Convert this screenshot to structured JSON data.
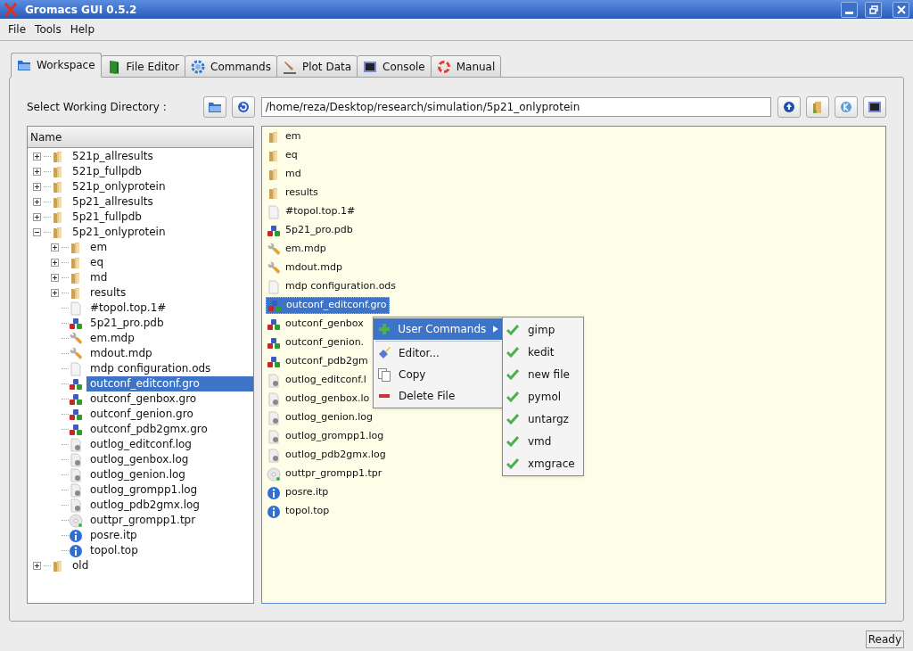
{
  "window": {
    "title": "Gromacs GUI 0.5.2"
  },
  "menubar": [
    "File",
    "Tools",
    "Help"
  ],
  "tabs": [
    {
      "label": "Workspace",
      "selected": true
    },
    {
      "label": "File Editor",
      "selected": false
    },
    {
      "label": "Commands",
      "selected": false
    },
    {
      "label": "Plot Data",
      "selected": false
    },
    {
      "label": "Console",
      "selected": false
    },
    {
      "label": "Manual",
      "selected": false
    }
  ],
  "directory": {
    "label": "Select Working Directory :",
    "path": "/home/reza/Desktop/research/simulation/5p21_onlyprotein"
  },
  "tree": {
    "column": "Name",
    "items": [
      {
        "label": "521p_allresults",
        "kind": "folder",
        "expanded": false,
        "selected": false
      },
      {
        "label": "521p_fullpdb",
        "kind": "folder",
        "expanded": false,
        "selected": false
      },
      {
        "label": "521p_onlyprotein",
        "kind": "folder",
        "expanded": false,
        "selected": false
      },
      {
        "label": "5p21_allresults",
        "kind": "folder",
        "expanded": false,
        "selected": false
      },
      {
        "label": "5p21_fullpdb",
        "kind": "folder",
        "expanded": false,
        "selected": false
      },
      {
        "label": "5p21_onlyprotein",
        "kind": "folder",
        "expanded": true,
        "selected": false,
        "children": [
          {
            "label": "em",
            "kind": "folder",
            "expanded": false,
            "selected": false
          },
          {
            "label": "eq",
            "kind": "folder",
            "expanded": false,
            "selected": false
          },
          {
            "label": "md",
            "kind": "folder",
            "expanded": false,
            "selected": false
          },
          {
            "label": "results",
            "kind": "folder",
            "expanded": false,
            "selected": false
          },
          {
            "label": "#topol.top.1#",
            "kind": "blank",
            "selected": false
          },
          {
            "label": "5p21_pro.pdb",
            "kind": "molecule",
            "selected": false
          },
          {
            "label": "em.mdp",
            "kind": "wrench",
            "selected": false
          },
          {
            "label": "mdout.mdp",
            "kind": "wrench",
            "selected": false
          },
          {
            "label": "mdp configuration.ods",
            "kind": "blank",
            "selected": false
          },
          {
            "label": "outconf_editconf.gro",
            "kind": "molecule",
            "selected": true
          },
          {
            "label": "outconf_genbox.gro",
            "kind": "molecule",
            "selected": false
          },
          {
            "label": "outconf_genion.gro",
            "kind": "molecule",
            "selected": false
          },
          {
            "label": "outconf_pdb2gmx.gro",
            "kind": "molecule",
            "selected": false
          },
          {
            "label": "outlog_editconf.log",
            "kind": "log",
            "selected": false
          },
          {
            "label": "outlog_genbox.log",
            "kind": "log",
            "selected": false
          },
          {
            "label": "outlog_genion.log",
            "kind": "log",
            "selected": false
          },
          {
            "label": "outlog_grompp1.log",
            "kind": "log",
            "selected": false
          },
          {
            "label": "outlog_pdb2gmx.log",
            "kind": "log",
            "selected": false
          },
          {
            "label": "outtpr_grompp1.tpr",
            "kind": "disc",
            "selected": false
          },
          {
            "label": "posre.itp",
            "kind": "info",
            "selected": false
          },
          {
            "label": "topol.top",
            "kind": "info",
            "selected": false
          }
        ]
      },
      {
        "label": "old",
        "kind": "folder",
        "expanded": false,
        "selected": false
      }
    ]
  },
  "files": [
    {
      "label": "em",
      "kind": "folder",
      "selected": false
    },
    {
      "label": "eq",
      "kind": "folder",
      "selected": false
    },
    {
      "label": "md",
      "kind": "folder",
      "selected": false
    },
    {
      "label": "results",
      "kind": "folder",
      "selected": false
    },
    {
      "label": "#topol.top.1#",
      "kind": "blank",
      "selected": false
    },
    {
      "label": "5p21_pro.pdb",
      "kind": "molecule",
      "selected": false
    },
    {
      "label": "em.mdp",
      "kind": "wrench",
      "selected": false
    },
    {
      "label": "mdout.mdp",
      "kind": "wrench",
      "selected": false
    },
    {
      "label": "mdp configuration.ods",
      "kind": "blank",
      "selected": false
    },
    {
      "label": "outconf_editconf.gro",
      "kind": "molecule",
      "selected": true
    },
    {
      "label": "outconf_genbox",
      "kind": "molecule",
      "selected": false
    },
    {
      "label": "outconf_genion.",
      "kind": "molecule",
      "selected": false
    },
    {
      "label": "outconf_pdb2gm",
      "kind": "molecule",
      "selected": false
    },
    {
      "label": "outlog_editconf.l",
      "kind": "log",
      "selected": false
    },
    {
      "label": "outlog_genbox.lo",
      "kind": "log",
      "selected": false
    },
    {
      "label": "outlog_genion.log",
      "kind": "log",
      "selected": false
    },
    {
      "label": "outlog_grompp1.log",
      "kind": "log",
      "selected": false
    },
    {
      "label": "outlog_pdb2gmx.log",
      "kind": "log",
      "selected": false
    },
    {
      "label": "outtpr_grompp1.tpr",
      "kind": "disc",
      "selected": false
    },
    {
      "label": "posre.itp",
      "kind": "info",
      "selected": false
    },
    {
      "label": "topol.top",
      "kind": "info",
      "selected": false
    }
  ],
  "context_menu": {
    "items": [
      {
        "label": "User Commands",
        "kind": "submenu",
        "selected": true
      },
      {
        "label": "Editor...",
        "kind": "editor",
        "selected": false
      },
      {
        "label": "Copy",
        "kind": "copy",
        "selected": false
      },
      {
        "label": "Delete File",
        "kind": "delete",
        "selected": false
      }
    ],
    "submenu": [
      "gimp",
      "kedit",
      "new file",
      "pymol",
      "untargz",
      "vmd",
      "xmgrace"
    ]
  },
  "status_bar": {
    "text": "Ready"
  }
}
